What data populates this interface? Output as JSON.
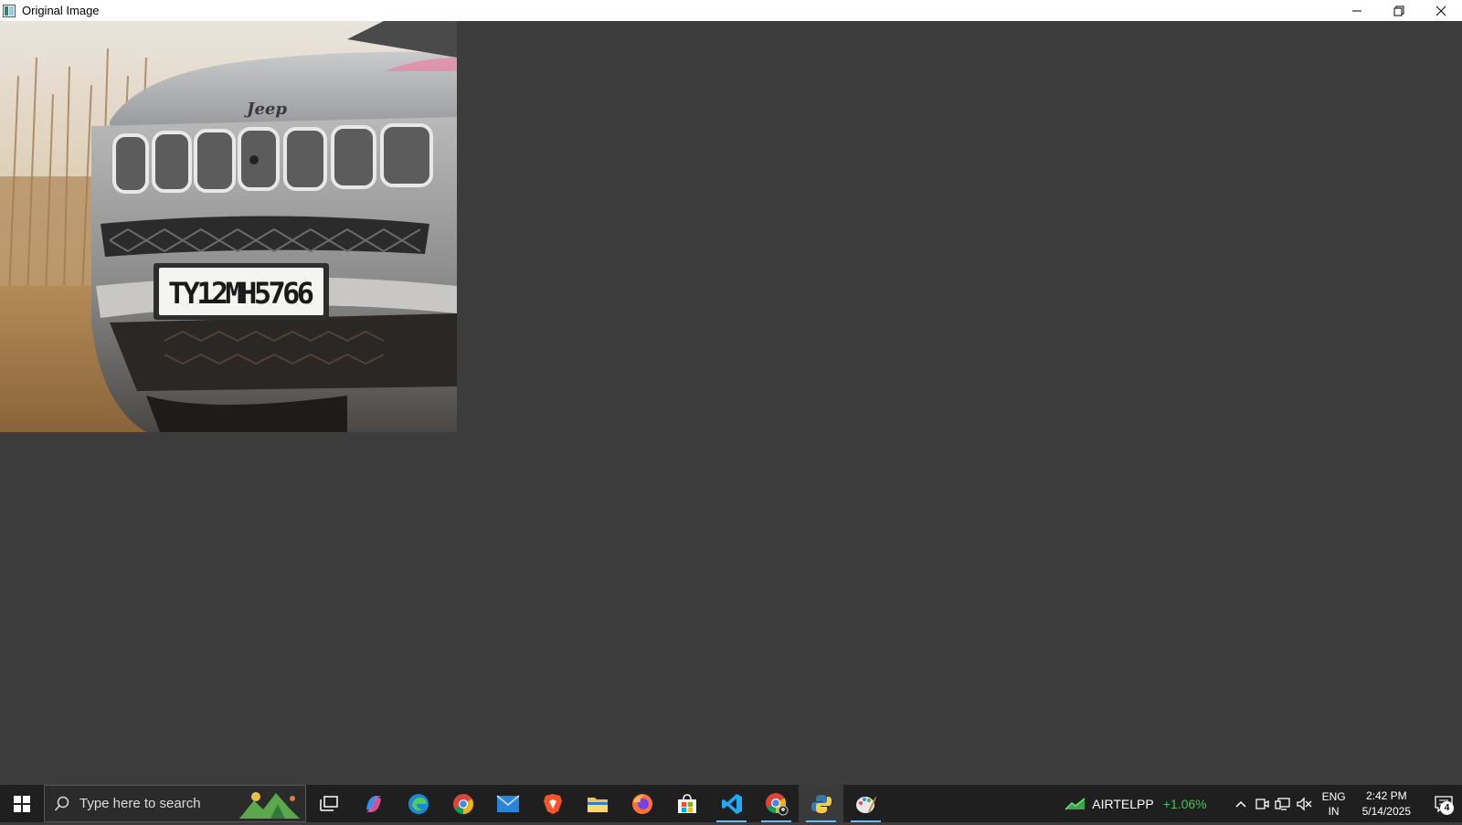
{
  "window": {
    "title": "Original Image"
  },
  "photo": {
    "subject": "Front of a silver Jeep SUV with grille and license plate",
    "badge_text": "Jeep",
    "plate_text": "TY12MH5766"
  },
  "taskbar": {
    "search_placeholder": "Type here to search",
    "pinned": [
      {
        "name": "task-view-icon"
      },
      {
        "name": "copilot-icon"
      },
      {
        "name": "edge-icon"
      },
      {
        "name": "chrome-icon"
      },
      {
        "name": "mail-icon"
      },
      {
        "name": "brave-icon"
      },
      {
        "name": "file-explorer-icon"
      },
      {
        "name": "firefox-icon"
      },
      {
        "name": "store-icon"
      },
      {
        "name": "vscode-icon"
      },
      {
        "name": "chrome-profile-icon"
      },
      {
        "name": "python-icon"
      },
      {
        "name": "paint-icon"
      }
    ]
  },
  "tray": {
    "stock_name": "AIRTELPP",
    "stock_change": "+1.06%",
    "lang_line1": "ENG",
    "lang_line2": "IN",
    "time": "2:42 PM",
    "date": "5/14/2025",
    "notification_count": "4"
  },
  "colors": {
    "client_bg": "#3c3c3c",
    "taskbar_bg": "#1f1f1f",
    "active_indicator": "#6cb8ff",
    "stock_up": "#49c15a"
  }
}
